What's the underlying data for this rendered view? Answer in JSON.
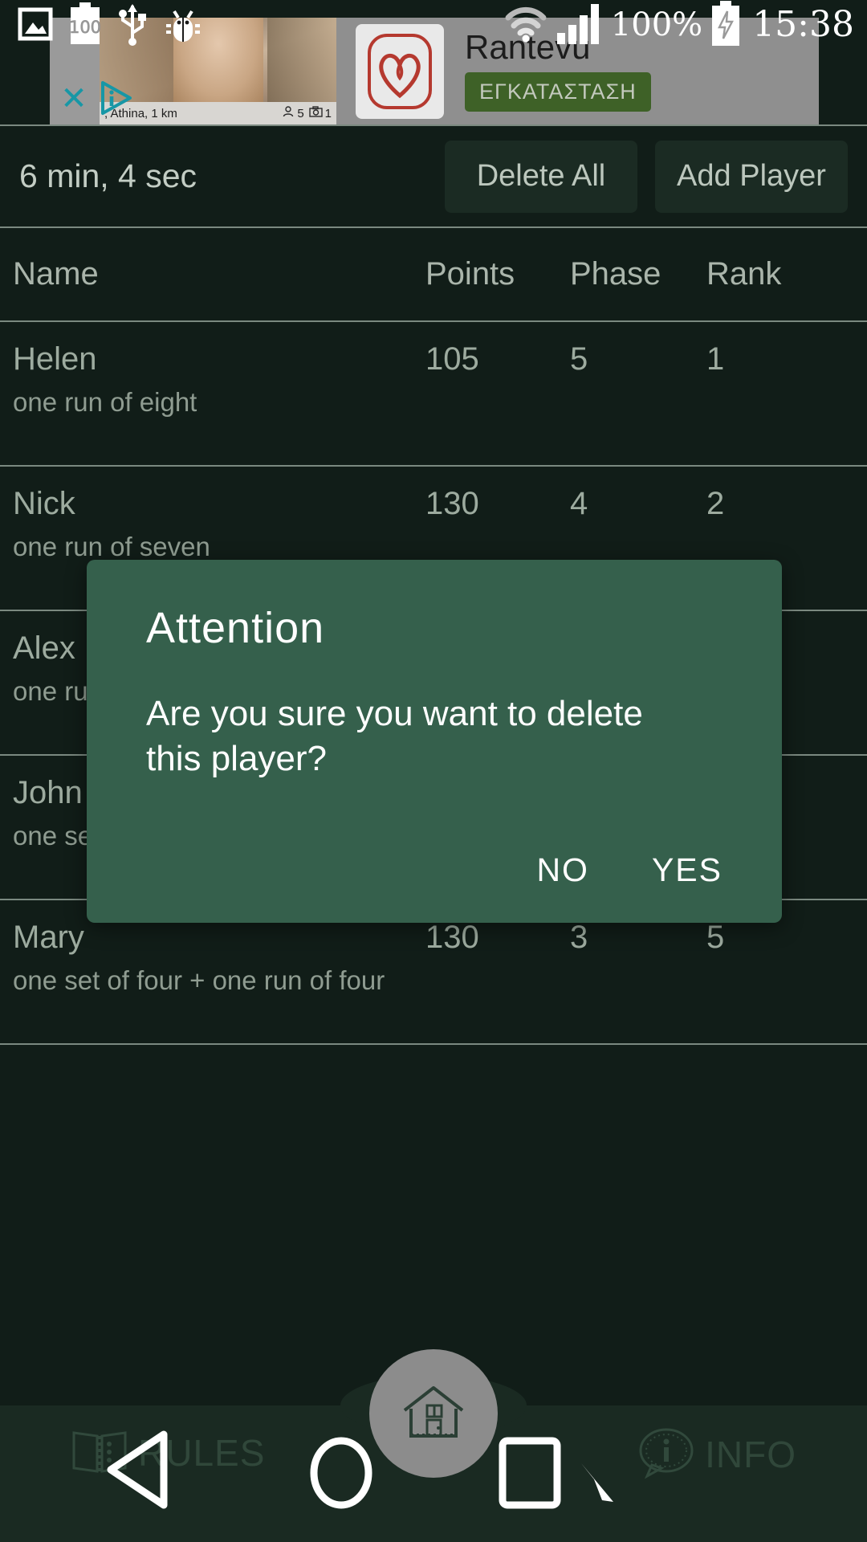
{
  "status_bar": {
    "icons": [
      "image-icon",
      "battery-100-icon",
      "usb-icon",
      "bug-icon"
    ],
    "battery_label": "100",
    "wifi_icon": "wifi-icon",
    "signal_icon": "signal-bars-icon",
    "battery_percent": "100%",
    "charging_icon": "battery-charging-icon",
    "clock": "15:38"
  },
  "ad": {
    "close_label": "✕",
    "adchoices_icon": "adchoices-icon",
    "caption_location": ", Athina, 1 km",
    "people_icon": "person-icon",
    "people_count": "5",
    "camera_icon": "camera-icon",
    "photo_count": "1",
    "logo_icon": "heart-logo-icon",
    "title": "Rantevu",
    "install_label": "ΕΓΚΑΤΑΣΤΑΣΗ"
  },
  "toolbar": {
    "timer": "6 min, 4 sec",
    "delete_all_label": "Delete All",
    "add_player_label": "Add Player"
  },
  "table": {
    "headers": {
      "name": "Name",
      "points": "Points",
      "phase": "Phase",
      "rank": "Rank"
    },
    "rows": [
      {
        "name": "Helen",
        "points": "105",
        "phase": "5",
        "rank": "1",
        "description": "one run of eight"
      },
      {
        "name": "Nick",
        "points": "130",
        "phase": "4",
        "rank": "2",
        "description": "one run of seven"
      },
      {
        "name": "Alex",
        "points": "",
        "phase": "",
        "rank": "",
        "description": "one ru"
      },
      {
        "name": "John",
        "points": "",
        "phase": "",
        "rank": "",
        "description": "one se"
      },
      {
        "name": "Mary",
        "points": "130",
        "phase": "3",
        "rank": "5",
        "description": "one set of four + one run of four"
      }
    ]
  },
  "dialog": {
    "title": "Attention",
    "message": "Are you sure you want to delete this player?",
    "no_label": "NO",
    "yes_label": "YES"
  },
  "bottom_bar": {
    "rules_label": "RULES",
    "rules_icon": "book-icon",
    "info_label": "INFO",
    "info_icon": "info-bubble-icon",
    "home_icon": "house-icon"
  },
  "nav_overlay": {
    "back_icon": "back-triangle-icon",
    "home_icon": "home-circle-icon",
    "recents_icon": "recents-square-icon",
    "cursor_icon": "cursor-arrow-icon"
  },
  "colors": {
    "app_background": "#111d18",
    "dialog_background": "#35604c",
    "bottom_bar": "#1a2a22",
    "install_button": "#3e6127",
    "accent_text": "#9dab9f"
  }
}
